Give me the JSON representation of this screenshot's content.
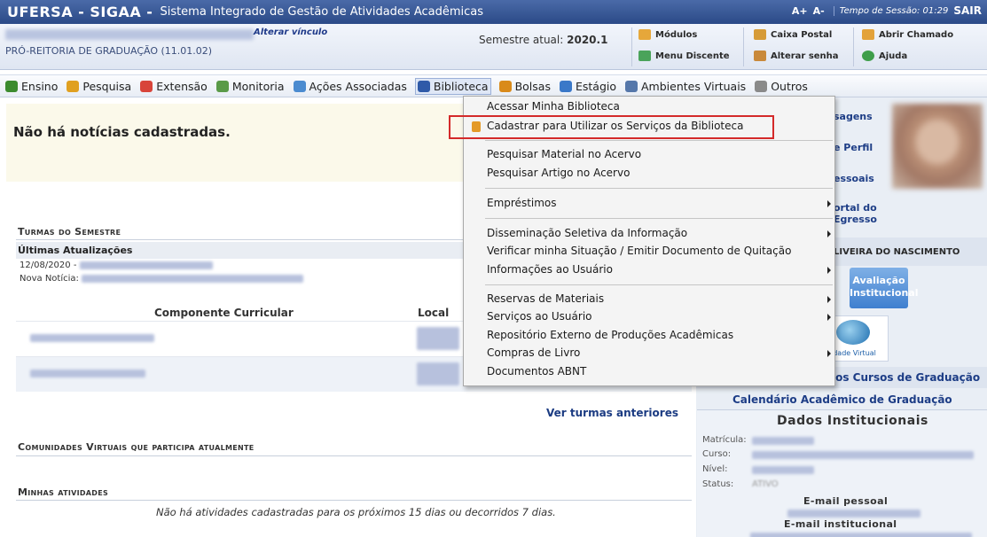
{
  "titlebar": {
    "brand": "UFERSA - SIGAA -",
    "subtitle": "Sistema Integrado de Gestão de Atividades Acadêmicas",
    "font_increase": "A+",
    "font_decrease": "A-",
    "session_label": "Tempo de Sessão: 01:29",
    "logout": "SAIR"
  },
  "user": {
    "change_link": "Alterar vínculo",
    "unit": "PRÓ-REITORIA DE GRADUAÇÃO (11.01.02)",
    "semester_label": "Semestre atual:",
    "semester_value": "2020.1"
  },
  "quick_links": {
    "modulos": "Módulos",
    "caixa_postal": "Caixa Postal",
    "abrir_chamado": "Abrir Chamado",
    "menu_discente": "Menu Discente",
    "alterar_senha": "Alterar senha",
    "ajuda": "Ajuda"
  },
  "menu": [
    {
      "label": "Ensino",
      "color": "#3c8b2e"
    },
    {
      "label": "Pesquisa",
      "color": "#e0a020"
    },
    {
      "label": "Extensão",
      "color": "#d8443a"
    },
    {
      "label": "Monitoria",
      "color": "#5a9a48"
    },
    {
      "label": "Ações Associadas",
      "color": "#4b8bd0"
    },
    {
      "label": "Biblioteca",
      "color": "#2f5aa8"
    },
    {
      "label": "Bolsas",
      "color": "#d98a1a"
    },
    {
      "label": "Estágio",
      "color": "#3a78c8"
    },
    {
      "label": "Ambientes Virtuais",
      "color": "#5577aa"
    },
    {
      "label": "Outros",
      "color": "#8a8a8a"
    }
  ],
  "news": {
    "empty_text": "Não há notícias cadastradas."
  },
  "sections": {
    "turmas": "Turmas do Semestre",
    "comunidades": "Comunidades Virtuais que participa atualmente",
    "atividades": "Minhas atividades"
  },
  "updates": {
    "header": "Últimas Atualizações",
    "date": "12/08/2020 -",
    "news_label": "Nova Notícia:"
  },
  "courses_table": {
    "col_component": "Componente Curricular",
    "col_local": "Local"
  },
  "links": {
    "ver_turmas": "Ver turmas anteriores",
    "calendario": "Calendário Acadêmico de Graduação"
  },
  "right": {
    "mensagens": "sagens",
    "perfil": "e Perfil",
    "pessoais": "essoais",
    "portal1": "ortal do",
    "portal2": "Egresso",
    "name_tail": "LIVEIRA DO NASCIMENTO",
    "avaliacao1": "Avaliação",
    "avaliacao2": "Institucional",
    "virtual_label": "idade Virtual",
    "cursos": "los Cursos de Graduação"
  },
  "dados": {
    "title": "Dados Institucionais",
    "matricula": "Matrícula:",
    "curso": "Curso:",
    "nivel": "Nível:",
    "status": "Status:",
    "status_value": "ATIVO",
    "email_pessoal": "E-mail pessoal",
    "email_institucional": "E-mail institucional"
  },
  "dropdown": {
    "items": [
      "Acessar Minha Biblioteca",
      "Cadastrar para Utilizar os Serviços da Biblioteca",
      "Pesquisar Material no Acervo",
      "Pesquisar Artigo no Acervo",
      "Empréstimos",
      "Disseminação Seletiva da Informação",
      "Verificar minha Situação / Emitir Documento de Quitação",
      "Informações ao Usuário",
      "Reservas de Materiais",
      "Serviços ao Usuário",
      "Repositório Externo de Produções Acadêmicas",
      "Compras de Livro",
      "Documentos ABNT"
    ]
  },
  "no_activities": "Não há atividades cadastradas para os próximos 15 dias ou decorridos 7 dias."
}
